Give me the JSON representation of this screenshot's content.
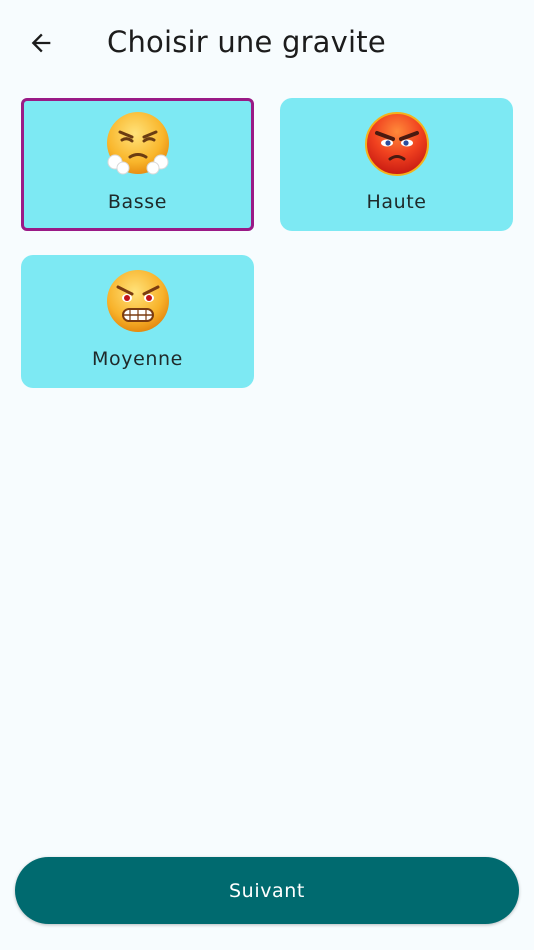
{
  "header": {
    "back_icon": "arrow-left-icon",
    "title": "Choisir une gravite"
  },
  "options": [
    {
      "label": "Basse",
      "icon": "steam-from-nose-face-icon",
      "selected": true
    },
    {
      "label": "Haute",
      "icon": "red-angry-face-icon",
      "selected": false
    },
    {
      "label": "Moyenne",
      "icon": "grimacing-angry-face-icon",
      "selected": false
    }
  ],
  "footer": {
    "next_label": "Suivant"
  },
  "colors": {
    "background": "#f7fcfe",
    "card": "#7de9f3",
    "selected_border": "#9a1a86",
    "primary_button": "#006a6f"
  }
}
